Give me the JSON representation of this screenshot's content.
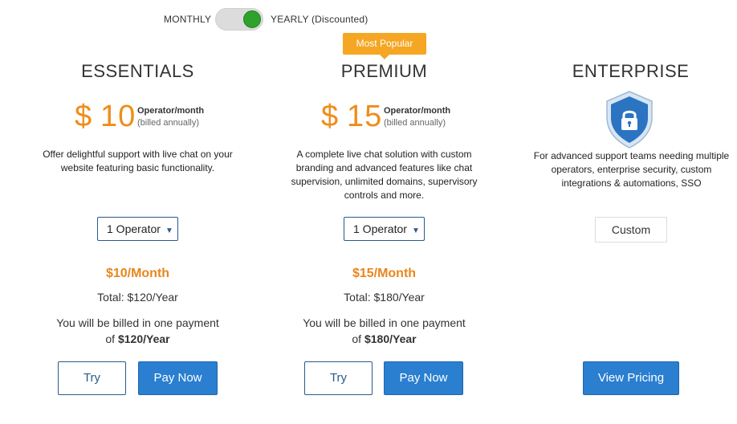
{
  "billing_toggle": {
    "monthly_label": "MONTHLY",
    "yearly_label": "YEARLY (Discounted)",
    "selected": "yearly",
    "knob_color": "#2fa22c"
  },
  "plans": {
    "essentials": {
      "name": "ESSENTIALS",
      "currency": "$",
      "price": "10",
      "unit": "Operator/month",
      "billed_note": "(billed annually)",
      "description": "Offer delightful support with live chat on your website featuring basic functionality.",
      "operator_select": "1 Operator",
      "monthly_total": "$10/Month",
      "yearly_total": "Total: $120/Year",
      "billing_text": "You will be billed in one payment",
      "billing_of": "of ",
      "billing_amount": "$120/Year",
      "try_label": "Try",
      "pay_label": "Pay Now"
    },
    "premium": {
      "badge": "Most Popular",
      "name": "PREMIUM",
      "currency": "$",
      "price": "15",
      "unit": "Operator/month",
      "billed_note": "(billed annually)",
      "description": "A complete live chat solution with custom branding and advanced features like chat supervision, unlimited domains, supervisory controls and more.",
      "operator_select": "1 Operator",
      "monthly_total": "$15/Month",
      "yearly_total": "Total: $180/Year",
      "billing_text": "You will be billed in one payment",
      "billing_of": "of ",
      "billing_amount": "$180/Year",
      "try_label": "Try",
      "pay_label": "Pay Now"
    },
    "enterprise": {
      "name": "ENTERPRISE",
      "icon": "shield-lock-icon",
      "description": "For advanced support teams needing multiple operators, enterprise security, custom integrations & automations, SSO",
      "custom_label": "Custom",
      "view_label": "View Pricing"
    }
  },
  "colors": {
    "price_orange": "#f08c1a",
    "badge_orange": "#f5a623",
    "primary_blue": "#2a7fd0",
    "outline_blue": "#2a5a8a"
  }
}
